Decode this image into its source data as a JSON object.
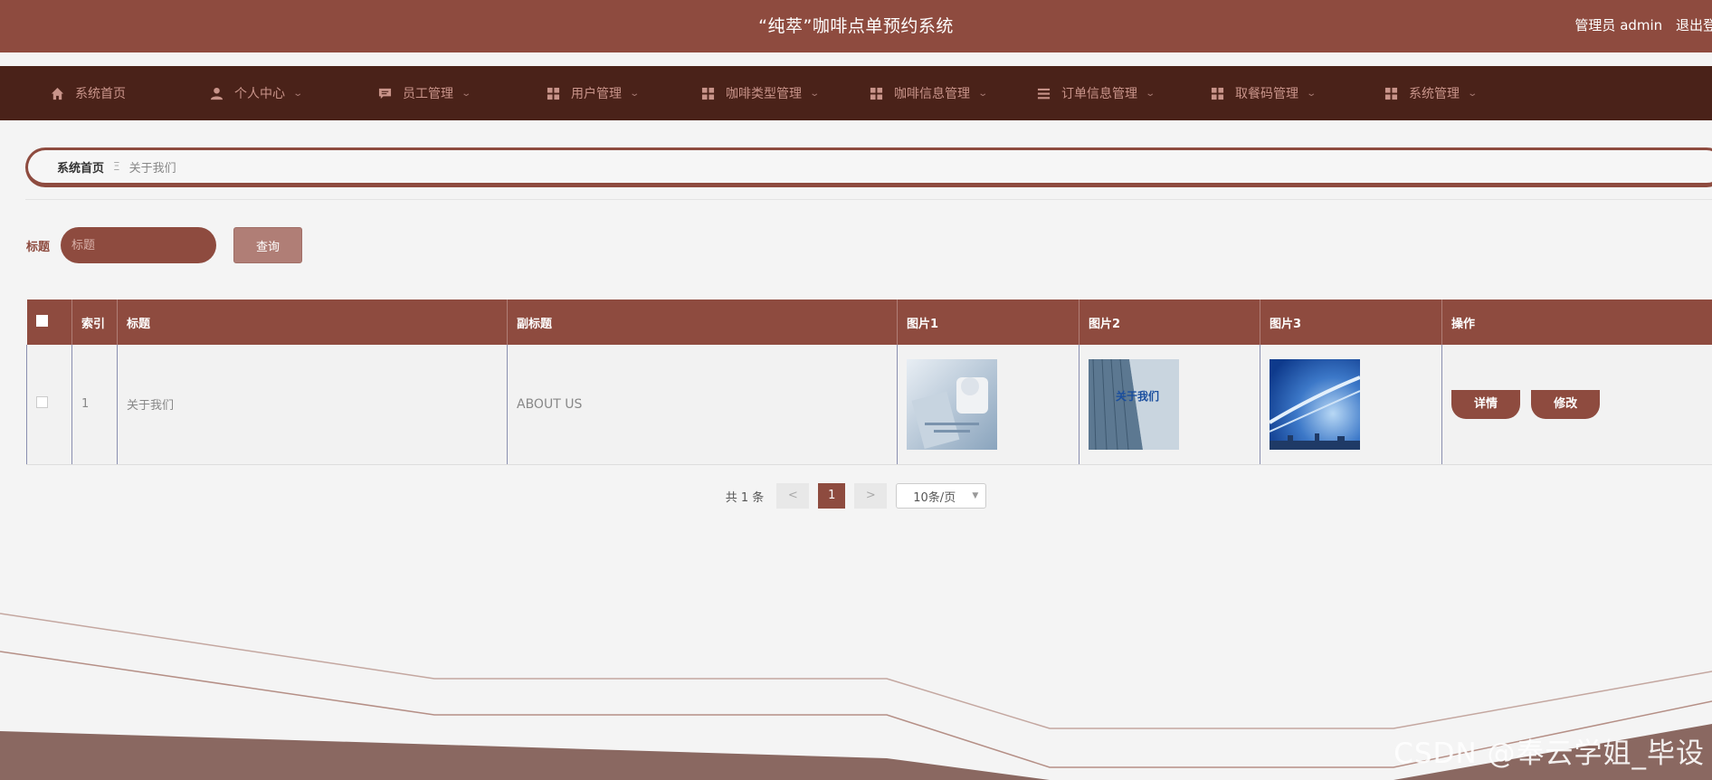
{
  "header": {
    "title": "“纯萃”咖啡点单预约系统",
    "user_role": "管理员 admin",
    "logout_label": "退出登录"
  },
  "nav": {
    "items": [
      {
        "label": "系统首页",
        "icon": "home-icon",
        "has_dropdown": false
      },
      {
        "label": "个人中心",
        "icon": "user-icon",
        "has_dropdown": true
      },
      {
        "label": "员工管理",
        "icon": "chat-icon",
        "has_dropdown": true
      },
      {
        "label": "用户管理",
        "icon": "grid-icon",
        "has_dropdown": true
      },
      {
        "label": "咖啡类型管理",
        "icon": "grid-icon",
        "has_dropdown": true
      },
      {
        "label": "咖啡信息管理",
        "icon": "grid-icon",
        "has_dropdown": true
      },
      {
        "label": "订单信息管理",
        "icon": "list-icon",
        "has_dropdown": true
      },
      {
        "label": "取餐码管理",
        "icon": "grid-icon",
        "has_dropdown": true
      },
      {
        "label": "系统管理",
        "icon": "grid-icon",
        "has_dropdown": true
      }
    ]
  },
  "breadcrumb": {
    "home": "系统首页",
    "separator": "Ξ",
    "current": "关于我们"
  },
  "search": {
    "label": "标题",
    "placeholder": "标题",
    "button": "查询"
  },
  "table": {
    "headers": [
      "索引",
      "标题",
      "副标题",
      "图片1",
      "图片2",
      "图片3",
      "操作"
    ],
    "rows": [
      {
        "index": "1",
        "title": "关于我们",
        "subtitle": "ABOUT US",
        "images": [
          "business-photo",
          "building-photo",
          "blue-sky-city-photo"
        ],
        "actions": [
          "详情",
          "修改"
        ]
      }
    ]
  },
  "pager": {
    "total": "共 1 条",
    "prev": "<",
    "page": "1",
    "next": ">",
    "page_size": "10条/页"
  },
  "colors": {
    "primary": "#8e4b3f",
    "nav_bg": "#4a2219",
    "nav_text": "#c9948a"
  },
  "watermark": "CSDN @奉云学姐_毕设"
}
